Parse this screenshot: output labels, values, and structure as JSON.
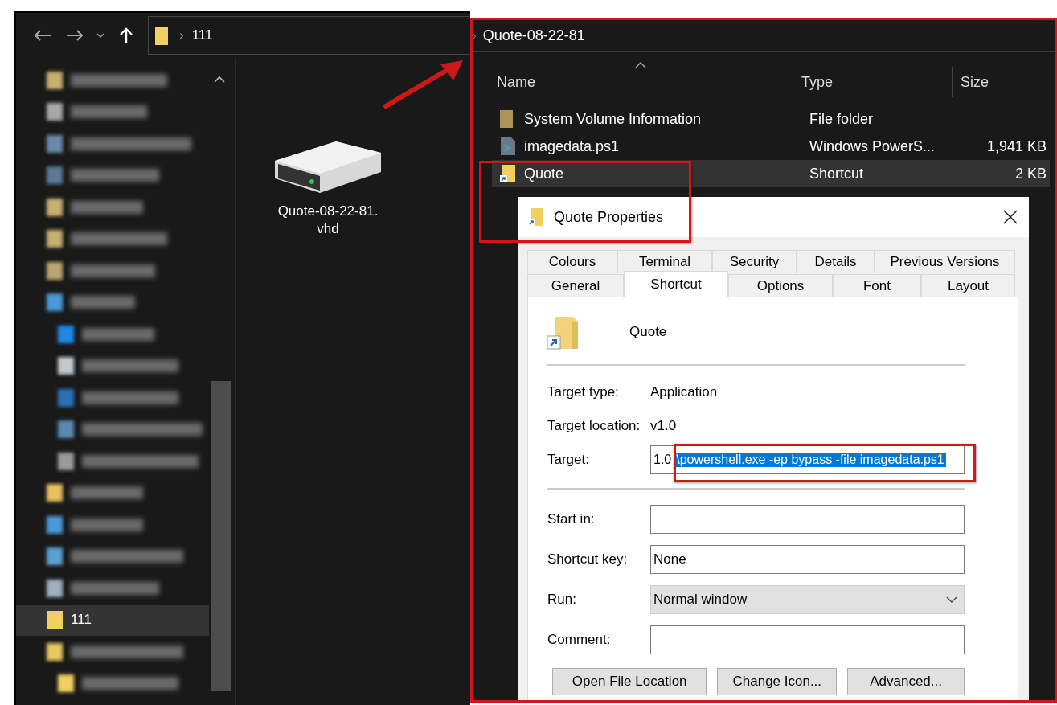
{
  "address": {
    "separator": "›",
    "path": "111"
  },
  "sidebar": {
    "items": [
      {
        "kind": "blurred",
        "color": "#c8b070",
        "selected": false
      },
      {
        "kind": "blurred",
        "color": "#a8a8a8",
        "selected": false
      },
      {
        "kind": "blurred",
        "color": "#6a8aa8",
        "selected": false
      },
      {
        "kind": "blurred",
        "color": "#5a7a98",
        "selected": false
      },
      {
        "kind": "blurred",
        "color": "#c8b070",
        "selected": false
      },
      {
        "kind": "blurred",
        "color": "#c8b070",
        "selected": false
      },
      {
        "kind": "blurred",
        "color": "#b8a870",
        "selected": false
      },
      {
        "kind": "blurred",
        "color": "#4a9ad8",
        "selected": false,
        "children": [
          {
            "kind": "blurred",
            "color": "#1e88e5",
            "selected": false
          },
          {
            "kind": "blurred",
            "color": "#c0c8d0",
            "selected": false
          },
          {
            "kind": "blurred",
            "color": "#2a70b8",
            "selected": false
          },
          {
            "kind": "blurred",
            "color": "#5a8ab0",
            "selected": false
          },
          {
            "kind": "blurred",
            "color": "#9a9a9a",
            "selected": false
          }
        ]
      },
      {
        "kind": "blurred",
        "color": "#e8c060",
        "selected": false
      },
      {
        "kind": "blurred",
        "color": "#4a9ad8",
        "selected": false
      },
      {
        "kind": "blurred",
        "color": "#5aa0d0",
        "selected": false
      },
      {
        "kind": "blurred",
        "color": "#a0b0c0",
        "selected": false
      },
      {
        "kind": "label",
        "label": "111",
        "color": "#f0d060",
        "selected": true
      },
      {
        "kind": "blurred",
        "color": "#e8c860",
        "selected": false,
        "children": [
          {
            "kind": "blurred",
            "color": "#f0d060",
            "selected": false
          }
        ]
      }
    ]
  },
  "drive": {
    "label": "Quote-08-22-81.vhd"
  },
  "folder": {
    "separator": "›",
    "title": "Quote-08-22-81",
    "columns": [
      {
        "label": "Name",
        "sorted": true
      },
      {
        "label": "Type"
      },
      {
        "label": "Size"
      }
    ],
    "rows": [
      {
        "kind": "folder",
        "name": "System Volume Information",
        "type": "File folder",
        "selected": false
      },
      {
        "kind": "script",
        "name": "imagedata.ps1",
        "type": "Windows PowerS...",
        "size": "1,941 KB",
        "selected": false
      },
      {
        "kind": "shortcut",
        "name": "Quote",
        "type": "Shortcut",
        "size": "2 KB",
        "selected": true
      }
    ]
  },
  "dialog": {
    "title": "Quote Properties",
    "tab_rows": [
      {
        "tabs": [
          {
            "label": "Colours",
            "selected": false
          },
          {
            "label": "Terminal",
            "selected": false
          },
          {
            "label": "Security",
            "selected": false
          },
          {
            "label": "Details",
            "selected": false
          },
          {
            "label": "Previous Versions",
            "selected": false
          }
        ]
      },
      {
        "tabs": [
          {
            "label": "General",
            "selected": false
          },
          {
            "label": "Shortcut",
            "selected": true
          },
          {
            "label": "Options",
            "selected": false
          },
          {
            "label": "Font",
            "selected": false
          },
          {
            "label": "Layout",
            "selected": false
          }
        ]
      }
    ],
    "name": "Quote",
    "info": [
      {
        "label": "Target type:",
        "value": "Application"
      },
      {
        "label": "Target location:",
        "value": "v1.0"
      }
    ],
    "target": {
      "label": "Target:",
      "value": "1.0",
      "selected_text": "\\powershell.exe -ep bypass -file imagedata.ps1"
    },
    "fields": [
      {
        "kind": "input",
        "label": "Start in:"
      },
      {
        "kind": "input",
        "label": "Shortcut key:",
        "value": "None"
      },
      {
        "kind": "dropdown",
        "label": "Run:",
        "value": "Normal window"
      },
      {
        "kind": "input",
        "label": "Comment:"
      }
    ],
    "buttons": [
      "Open File Location",
      "Change Icon...",
      "Advanced..."
    ]
  }
}
